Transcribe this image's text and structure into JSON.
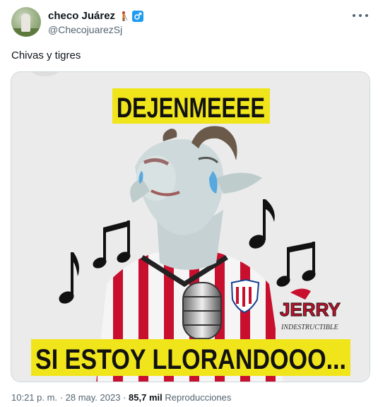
{
  "author": {
    "display_name": "checo Juárez",
    "handle": "@ChecojuarezSj",
    "avatar_icon": "profile-photo-avatar",
    "badges": [
      "golfer-icon",
      "male-sign-icon"
    ]
  },
  "tweet": {
    "text": "Chivas y tigres",
    "meme": {
      "top_text": "DEJENMEEEE",
      "bottom_text": "SI ESTOY LLORANDOOO...",
      "watermark": "JERRY",
      "watermark_sub": "INDESTRUCTIBLE",
      "top_text_bg": "#f0e51b",
      "bottom_text_bg": "#f0e51b"
    }
  },
  "footer": {
    "time": "10:21 p. m.",
    "separator": "·",
    "date": "28 may. 2023",
    "views_count": "85,7 mil",
    "views_label": "Reproducciones"
  },
  "colors": {
    "accent": "#1d9bf0",
    "text": "#0f1419",
    "muted": "#536471"
  }
}
